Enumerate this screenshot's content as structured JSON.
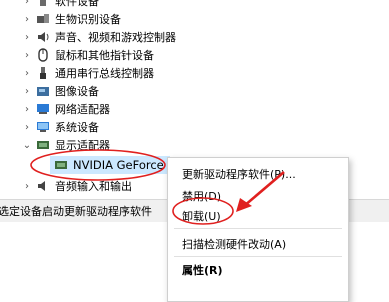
{
  "tree": {
    "items": [
      {
        "label": "软件设备",
        "chevron": "›",
        "icon": "software-device-icon"
      },
      {
        "label": "生物识别设备",
        "chevron": "›",
        "icon": "biometric-icon"
      },
      {
        "label": "声音、视频和游戏控制器",
        "chevron": "›",
        "icon": "speaker-icon"
      },
      {
        "label": "鼠标和其他指针设备",
        "chevron": "›",
        "icon": "mouse-icon"
      },
      {
        "label": "通用串行总线控制器",
        "chevron": "›",
        "icon": "usb-icon"
      },
      {
        "label": "图像设备",
        "chevron": "›",
        "icon": "camera-icon"
      },
      {
        "label": "网络适配器",
        "chevron": "›",
        "icon": "network-adapter-icon"
      },
      {
        "label": "系统设备",
        "chevron": "›",
        "icon": "system-device-icon"
      },
      {
        "label": "显示适配器",
        "chevron": "⌄",
        "icon": "display-adapter-icon"
      },
      {
        "label": "NVIDIA GeForce",
        "chevron": "",
        "icon": "gpu-icon"
      },
      {
        "label": "音频输入和输出",
        "chevron": "›",
        "icon": "audio-io-icon"
      }
    ]
  },
  "status_bar": {
    "text": "选定设备启动更新驱动程序软件"
  },
  "context_menu": {
    "items": [
      {
        "label": "更新驱动程序软件(P)..."
      },
      {
        "label": "禁用(D)"
      },
      {
        "label": "卸载(U)"
      },
      {
        "label": "扫描检测硬件改动(A)"
      },
      {
        "label": "属性(R)"
      }
    ]
  },
  "colors": {
    "annotation_red": "#e0201f",
    "highlight": "#cce8ff",
    "icon_blue": "#2a7ad5"
  }
}
